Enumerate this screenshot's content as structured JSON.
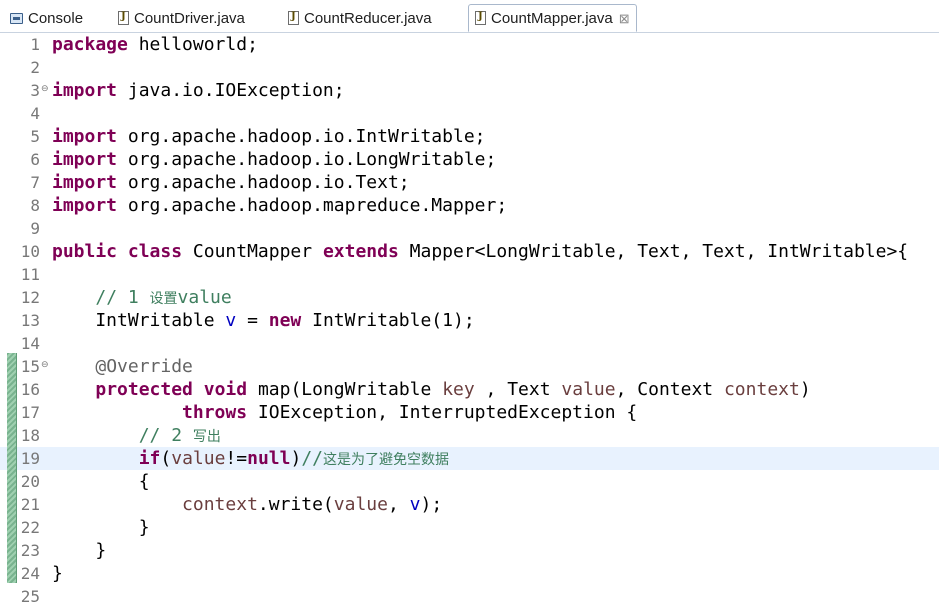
{
  "tabs": [
    {
      "label": "Console",
      "icon": "console-icon",
      "active": false
    },
    {
      "label": "CountDriver.java",
      "icon": "java-file-icon",
      "active": false
    },
    {
      "label": "CountReducer.java",
      "icon": "java-file-icon",
      "active": false
    },
    {
      "label": "CountMapper.java",
      "icon": "java-file-icon",
      "active": true,
      "close": "⊠"
    }
  ],
  "editor": {
    "lines": [
      {
        "n": "1",
        "tokens": [
          [
            "kw",
            "package"
          ],
          [
            "",
            "helloworld;"
          ]
        ]
      },
      {
        "n": "2",
        "tokens": []
      },
      {
        "n": "3",
        "fold": "⊖",
        "tokens": [
          [
            "kw",
            "import"
          ],
          [
            "",
            " java.io.IOException;"
          ]
        ]
      },
      {
        "n": "4",
        "tokens": []
      },
      {
        "n": "5",
        "tokens": [
          [
            "kw",
            "import"
          ],
          [
            "",
            " org.apache.hadoop.io.IntWritable;"
          ]
        ]
      },
      {
        "n": "6",
        "tokens": [
          [
            "kw",
            "import"
          ],
          [
            "",
            " org.apache.hadoop.io.LongWritable;"
          ]
        ]
      },
      {
        "n": "7",
        "tokens": [
          [
            "kw",
            "import"
          ],
          [
            "",
            " org.apache.hadoop.io.Text;"
          ]
        ]
      },
      {
        "n": "8",
        "tokens": [
          [
            "kw",
            "import"
          ],
          [
            "",
            " org.apache.hadoop.mapreduce.Mapper;"
          ]
        ]
      },
      {
        "n": "9",
        "tokens": []
      },
      {
        "n": "10",
        "tokens": [
          [
            "kw",
            "public"
          ],
          [
            "",
            " "
          ],
          [
            "kw",
            "class"
          ],
          [
            "",
            " CountMapper "
          ],
          [
            "kw",
            "extends"
          ],
          [
            "",
            " Mapper<LongWritable, Text, Text, IntWritable>{"
          ]
        ]
      },
      {
        "n": "11",
        "tokens": []
      },
      {
        "n": "12",
        "tokens": [
          [
            "",
            "    "
          ],
          [
            "cm",
            "// 1 "
          ],
          [
            "cmcjk",
            "设置"
          ],
          [
            "cm",
            "value"
          ]
        ]
      },
      {
        "n": "13",
        "tokens": [
          [
            "",
            "    IntWritable "
          ],
          [
            "fd",
            "v"
          ],
          [
            "",
            " = "
          ],
          [
            "kw",
            "new"
          ],
          [
            "",
            " IntWritable(1);"
          ]
        ]
      },
      {
        "n": "14",
        "tokens": []
      },
      {
        "n": "15",
        "fold": "⊖",
        "tokens": [
          [
            "",
            "    "
          ],
          [
            "an",
            "@Override"
          ]
        ]
      },
      {
        "n": "16",
        "tokens": [
          [
            "",
            "    "
          ],
          [
            "kw",
            "protected"
          ],
          [
            "",
            " "
          ],
          [
            "kw",
            "void"
          ],
          [
            "",
            " map(LongWritable "
          ],
          [
            "pm",
            "key"
          ],
          [
            "",
            " , Text "
          ],
          [
            "pm",
            "value"
          ],
          [
            "",
            ", Context "
          ],
          [
            "pm",
            "context"
          ],
          [
            "",
            ")"
          ]
        ]
      },
      {
        "n": "17",
        "tokens": [
          [
            "",
            "            "
          ],
          [
            "kw",
            "throws"
          ],
          [
            "",
            " IOException, InterruptedException {"
          ]
        ]
      },
      {
        "n": "18",
        "tokens": [
          [
            "",
            "        "
          ],
          [
            "cm",
            "// 2 "
          ],
          [
            "cmcjk",
            "写出"
          ]
        ]
      },
      {
        "n": "19",
        "current": true,
        "tokens": [
          [
            "",
            "        "
          ],
          [
            "kw",
            "if"
          ],
          [
            "",
            "("
          ],
          [
            "pm",
            "value"
          ],
          [
            "",
            "!="
          ],
          [
            "kw",
            "null"
          ],
          [
            "",
            ")"
          ],
          [
            "cm",
            "//"
          ],
          [
            "cmcjk",
            "这是为了避免空数据"
          ]
        ]
      },
      {
        "n": "20",
        "tokens": [
          [
            "",
            "        {"
          ]
        ]
      },
      {
        "n": "21",
        "tokens": [
          [
            "",
            "            "
          ],
          [
            "pm",
            "context"
          ],
          [
            "",
            ".write("
          ],
          [
            "pm",
            "value"
          ],
          [
            "",
            ", "
          ],
          [
            "fd",
            "v"
          ],
          [
            "",
            ");"
          ]
        ]
      },
      {
        "n": "22",
        "tokens": [
          [
            "",
            "        }"
          ]
        ]
      },
      {
        "n": "23",
        "tokens": [
          [
            "",
            "    }"
          ]
        ]
      },
      {
        "n": "24",
        "tokens": [
          [
            "",
            "}"
          ]
        ]
      },
      {
        "n": "25",
        "tokens": []
      }
    ]
  }
}
